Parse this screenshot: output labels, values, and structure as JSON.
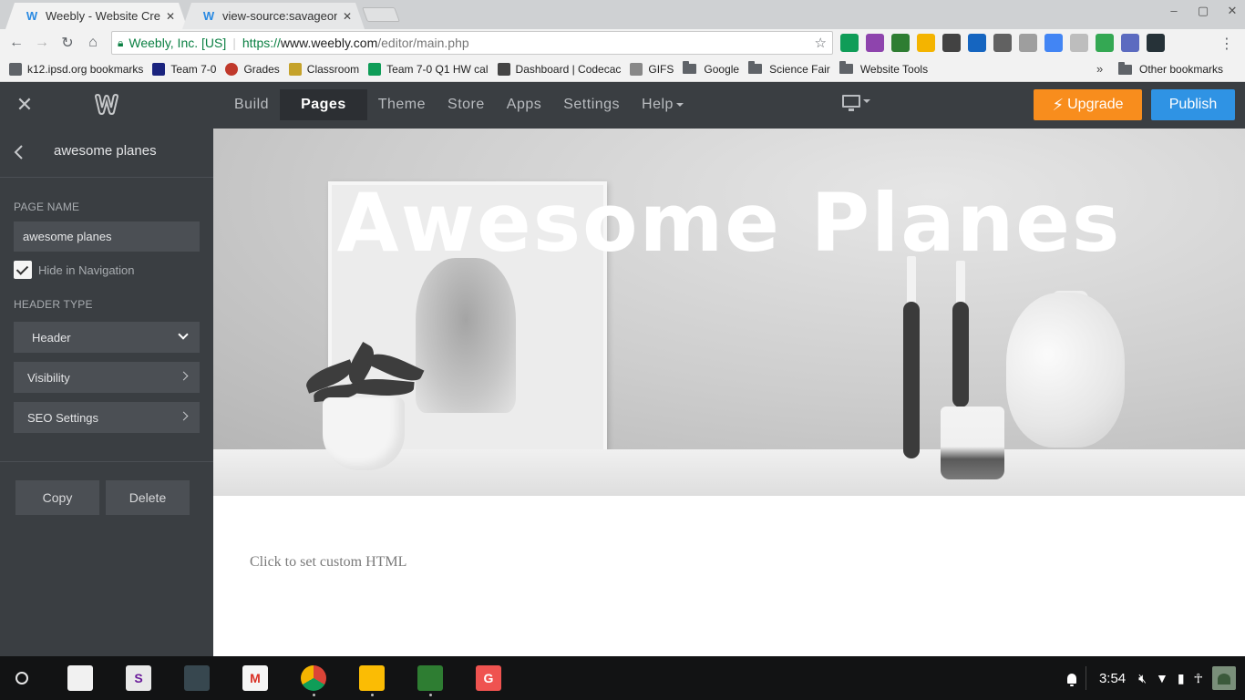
{
  "browser": {
    "tabs": [
      {
        "title": "Weebly - Website Creation",
        "active": true
      },
      {
        "title": "view-source:savageonly",
        "active": false
      }
    ],
    "window_controls": {
      "minimize": "–",
      "restore": "▢",
      "close": "✕"
    },
    "tab_close": "✕",
    "address": {
      "cert": "Weebly, Inc. [US]",
      "scheme": "https://",
      "host": "www.weebly.com",
      "path": "/editor/main.php"
    },
    "bookmarks": [
      {
        "label": "k12.ipsd.org bookmarks",
        "icon": "bookmark-page-icon",
        "color": "#5f6368"
      },
      {
        "label": "Team 7-0",
        "icon": "team-icon",
        "color": "#1a237e"
      },
      {
        "label": "Grades",
        "icon": "grades-icon",
        "color": "#c0392b"
      },
      {
        "label": "Classroom",
        "icon": "classroom-icon",
        "color": "#c5a22a"
      },
      {
        "label": "Team 7-0 Q1 HW cal",
        "icon": "sheets-icon",
        "color": "#0f9d58"
      },
      {
        "label": "Dashboard | Codecac",
        "icon": "codecademy-icon",
        "color": "#444444"
      },
      {
        "label": "GIFS",
        "icon": "page-icon",
        "color": "#888888"
      },
      {
        "label": "Google",
        "icon": "folder-icon",
        "color": "#5f6368"
      },
      {
        "label": "Science Fair",
        "icon": "folder-icon",
        "color": "#5f6368"
      },
      {
        "label": "Website Tools",
        "icon": "folder-icon",
        "color": "#5f6368"
      }
    ],
    "bookmarks_overflow": "»",
    "other_bookmarks": "Other bookmarks",
    "extension_colors": [
      "#0f9d58",
      "#8e44ad",
      "#2e7d32",
      "#f4b400",
      "#424242",
      "#1565c0",
      "#616161",
      "#9e9e9e",
      "#4285f4",
      "#bdbdbd",
      "#34a853",
      "#5c6bc0",
      "#263238"
    ]
  },
  "editor": {
    "close_icon": "✕",
    "nav": [
      {
        "label": "Build",
        "active": false
      },
      {
        "label": "Pages",
        "active": true
      },
      {
        "label": "Theme",
        "active": false
      },
      {
        "label": "Store",
        "active": false
      },
      {
        "label": "Apps",
        "active": false
      },
      {
        "label": "Settings",
        "active": false
      },
      {
        "label": "Help",
        "active": false
      }
    ],
    "upgrade_label": "Upgrade",
    "publish_label": "Publish",
    "colors": {
      "bar": "#3a3e42",
      "upgrade": "#f88d1d",
      "publish": "#2f93e4"
    }
  },
  "panel": {
    "title": "awesome planes",
    "page_name_label": "PAGE NAME",
    "page_name_value": "awesome planes",
    "hide_in_navigation_label": "Hide in Navigation",
    "hide_in_navigation_checked": true,
    "header_type_label": "HEADER TYPE",
    "header_type_value": "Header",
    "visibility_label": "Visibility",
    "seo_label": "SEO Settings",
    "copy_label": "Copy",
    "delete_label": "Delete"
  },
  "canvas": {
    "hero_title": "Awesome Planes",
    "custom_html_prompt": "Click to set custom HTML"
  },
  "shelf": {
    "apps": [
      {
        "name": "chrome-canary-app",
        "color": "#f1f1f1"
      },
      {
        "name": "slides-app",
        "color": "#e9e9e9"
      },
      {
        "name": "calculator-app",
        "color": "#37474f"
      },
      {
        "name": "gmail-app",
        "color": "#f5f5f5"
      },
      {
        "name": "chrome-app",
        "color": "#ffffff"
      },
      {
        "name": "drive-app",
        "color": "#fbbc04"
      },
      {
        "name": "classroom-app",
        "color": "#2e7d32"
      },
      {
        "name": "g-app",
        "color": "#ef5350"
      }
    ],
    "g_app_letter": "G",
    "time": "3:54"
  }
}
